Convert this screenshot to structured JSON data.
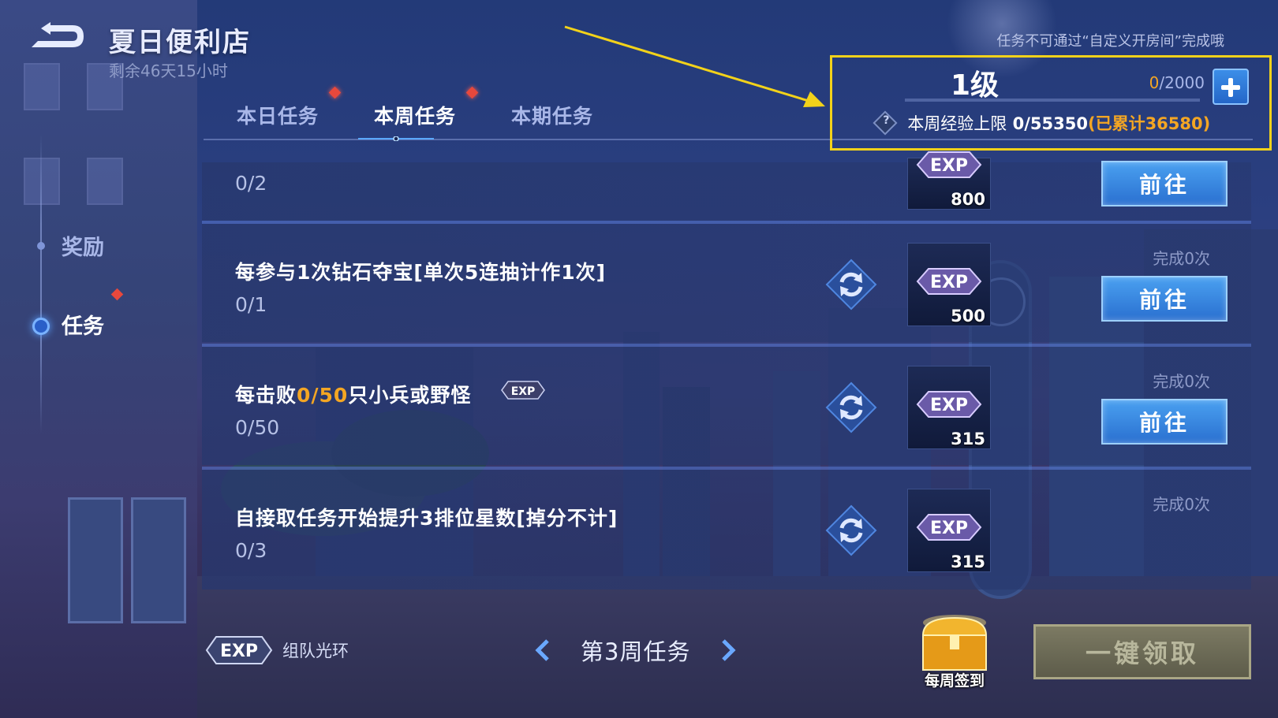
{
  "header": {
    "title": "夏日便利店",
    "remaining": "剩余46天15小时",
    "notice": "任务不可通过“自定义开房间”完成哦"
  },
  "tabs": [
    {
      "label": "本日任务",
      "active": false,
      "badge": true
    },
    {
      "label": "本周任务",
      "active": true,
      "badge": true
    },
    {
      "label": "本期任务",
      "active": false,
      "badge": false
    }
  ],
  "level": {
    "label": "1级",
    "progress_current": "0",
    "progress_max": "/2000",
    "cap_label": "本周经验上限",
    "cap_value": "0/55350",
    "cap_accumulated": "(已累计36580)"
  },
  "side_nav": {
    "reward": "奖励",
    "task": "任务"
  },
  "tasks": [
    {
      "title": "",
      "progress": "0/2",
      "exp": "800",
      "done": "",
      "button": "前往"
    },
    {
      "title": "每参与1次钻石夺宝[单次5连抽计作1次]",
      "progress": "0/1",
      "exp": "500",
      "done": "完成0次",
      "button": "前往"
    },
    {
      "title_pre": "每击败",
      "title_hl": "0/50",
      "title_post": "只小兵或野怪",
      "progress": "0/50",
      "exp": "315",
      "done": "完成0次",
      "button": "前往"
    },
    {
      "title": "自接取任务开始提升3排位星数[掉分不计]",
      "progress": "0/3",
      "exp": "315",
      "done": "完成0次",
      "button": ""
    }
  ],
  "footer": {
    "team_aura": "组队光环",
    "week_label": "第3周任务",
    "weekly_signin": "每周签到",
    "claim_all": "一键领取"
  },
  "colors": {
    "accent_gold": "#f4a623",
    "highlight_box": "#f2d21a",
    "button_blue": "#2a70d0",
    "badge_red": "#e8483c"
  }
}
